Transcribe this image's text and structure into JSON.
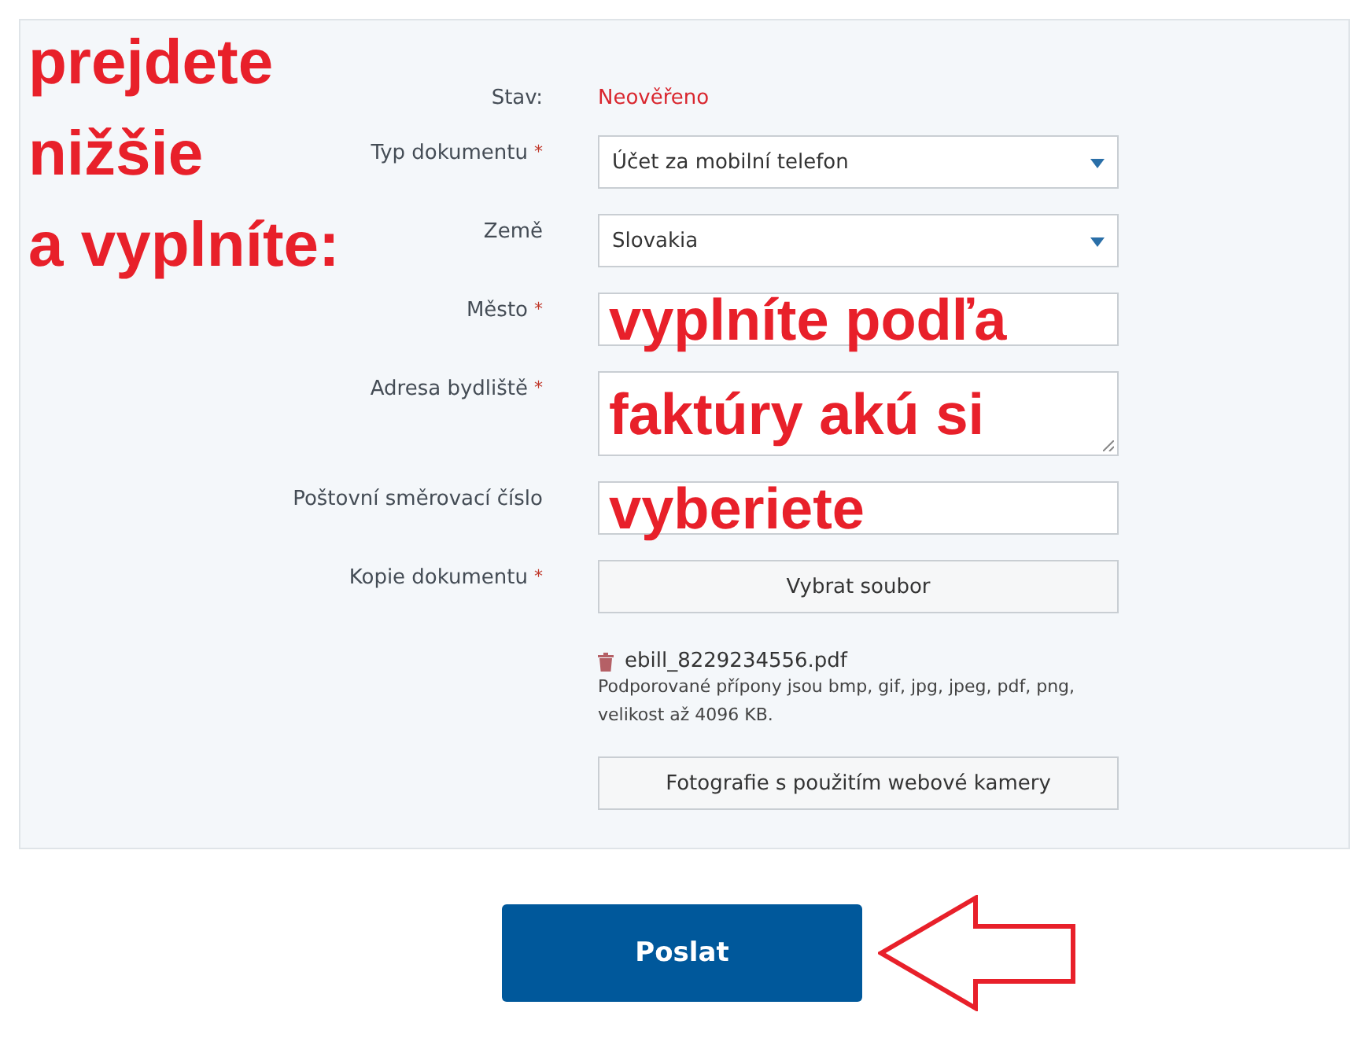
{
  "annotation": {
    "lines": [
      "prejdete",
      "nižšie",
      "a vyplníte:"
    ]
  },
  "required_mark": "*",
  "form": {
    "rows": [
      {
        "kind": "status",
        "label": "Stav:",
        "required": false,
        "value": "Neověřeno"
      },
      {
        "kind": "select",
        "label": "Typ dokumentu",
        "required": true,
        "value": "Účet za mobilní telefon"
      },
      {
        "kind": "select",
        "label": "Země",
        "required": false,
        "value": "Slovakia"
      },
      {
        "kind": "text",
        "label": "Město",
        "required": true,
        "overlay": "vyplníte podľa"
      },
      {
        "kind": "textarea",
        "label": "Adresa bydliště",
        "required": true,
        "overlay": "faktúry akú si"
      },
      {
        "kind": "text",
        "label": "Poštovní směrovací číslo",
        "required": false,
        "overlay": "vyberiete"
      },
      {
        "kind": "file",
        "label": "Kopie dokumentu",
        "required": true,
        "button": "Vybrat soubor",
        "file_name": "ebill_8229234556.pdf",
        "hint": "Podporované přípony jsou bmp, gif, jpg, jpeg, pdf, png, velikost až 4096 KB.",
        "camera_button": "Fotografie s použitím webové kamery"
      }
    ]
  },
  "submit": "Poslat"
}
